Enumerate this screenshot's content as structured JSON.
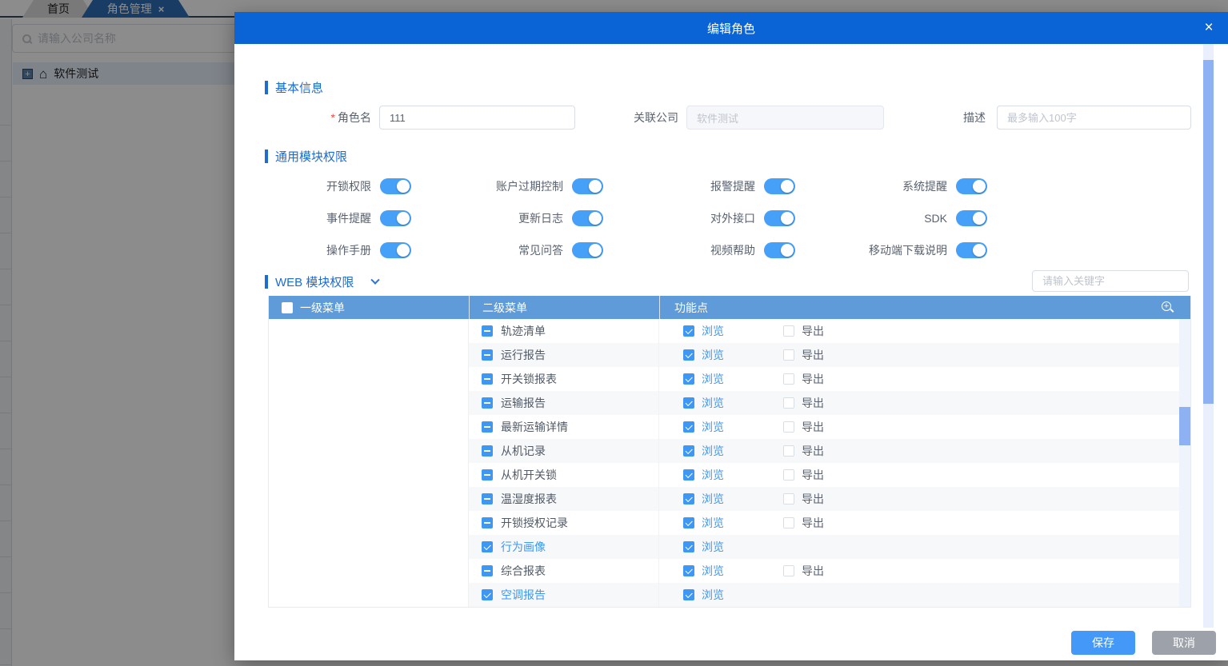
{
  "page_background": {
    "tabs": [
      {
        "label": "首页",
        "active": false
      },
      {
        "label": "角色管理",
        "active": true,
        "close": "×"
      }
    ],
    "company_search_placeholder": "请输入公司名称",
    "tree_item_label": "软件测试"
  },
  "modal": {
    "title": "编辑角色",
    "close": "×",
    "basic_section": {
      "title": "基本信息",
      "role_name": {
        "label": "角色名",
        "required": "*",
        "value": "111"
      },
      "company": {
        "label": "关联公司",
        "value": "软件测试",
        "disabled": true
      },
      "description": {
        "label": "描述",
        "placeholder": "最多输入100字"
      }
    },
    "common_section": {
      "title": "通用模块权限",
      "toggles": [
        {
          "label": "开锁权限",
          "on": true
        },
        {
          "label": "账户过期控制",
          "on": true
        },
        {
          "label": "报警提醒",
          "on": true
        },
        {
          "label": "系统提醒",
          "on": true
        },
        {
          "label": "事件提醒",
          "on": true
        },
        {
          "label": "更新日志",
          "on": true
        },
        {
          "label": "对外接口",
          "on": true
        },
        {
          "label": "SDK",
          "on": true
        },
        {
          "label": "操作手册",
          "on": true
        },
        {
          "label": "常见问答",
          "on": true
        },
        {
          "label": "视频帮助",
          "on": true
        },
        {
          "label": "移动端下载说明",
          "on": true
        }
      ]
    },
    "web_section": {
      "title": "WEB 模块权限",
      "keyword_placeholder": "请输入关键字",
      "table": {
        "columns": [
          "一级菜单",
          "二级菜单",
          "功能点"
        ],
        "rows": [
          {
            "menu": "轨迹清单",
            "state": "indeterminate",
            "functions": [
              {
                "label": "浏览",
                "checked": true
              },
              {
                "label": "导出",
                "checked": false
              }
            ]
          },
          {
            "menu": "运行报告",
            "state": "indeterminate",
            "functions": [
              {
                "label": "浏览",
                "checked": true
              },
              {
                "label": "导出",
                "checked": false
              }
            ]
          },
          {
            "menu": "开关锁报表",
            "state": "indeterminate",
            "functions": [
              {
                "label": "浏览",
                "checked": true
              },
              {
                "label": "导出",
                "checked": false
              }
            ]
          },
          {
            "menu": "运输报告",
            "state": "indeterminate",
            "functions": [
              {
                "label": "浏览",
                "checked": true
              },
              {
                "label": "导出",
                "checked": false
              }
            ]
          },
          {
            "menu": "最新运输详情",
            "state": "indeterminate",
            "functions": [
              {
                "label": "浏览",
                "checked": true
              },
              {
                "label": "导出",
                "checked": false
              }
            ]
          },
          {
            "menu": "从机记录",
            "state": "indeterminate",
            "functions": [
              {
                "label": "浏览",
                "checked": true
              },
              {
                "label": "导出",
                "checked": false
              }
            ]
          },
          {
            "menu": "从机开关锁",
            "state": "indeterminate",
            "functions": [
              {
                "label": "浏览",
                "checked": true
              },
              {
                "label": "导出",
                "checked": false
              }
            ]
          },
          {
            "menu": "温湿度报表",
            "state": "indeterminate",
            "functions": [
              {
                "label": "浏览",
                "checked": true
              },
              {
                "label": "导出",
                "checked": false
              }
            ]
          },
          {
            "menu": "开锁授权记录",
            "state": "indeterminate",
            "functions": [
              {
                "label": "浏览",
                "checked": true
              },
              {
                "label": "导出",
                "checked": false
              }
            ]
          },
          {
            "menu": "行为画像",
            "state": "checked",
            "functions": [
              {
                "label": "浏览",
                "checked": true
              }
            ]
          },
          {
            "menu": "综合报表",
            "state": "indeterminate",
            "functions": [
              {
                "label": "浏览",
                "checked": true
              },
              {
                "label": "导出",
                "checked": false
              }
            ]
          },
          {
            "menu": "空调报告",
            "state": "checked",
            "functions": [
              {
                "label": "浏览",
                "checked": true
              }
            ]
          }
        ]
      }
    },
    "footer": {
      "save_label": "保存",
      "cancel_label": "取消"
    }
  },
  "colors": {
    "modal_header": "#0a64d6",
    "section_title": "#1e6bd4",
    "primary_blue": "#3e97f3",
    "table_header": "#5e9bd8",
    "toggle_on": "#46a0f7",
    "save_button": "#4499f8",
    "cancel_button": "#9da2aa",
    "scroll_thumb": "#8db1f3"
  }
}
